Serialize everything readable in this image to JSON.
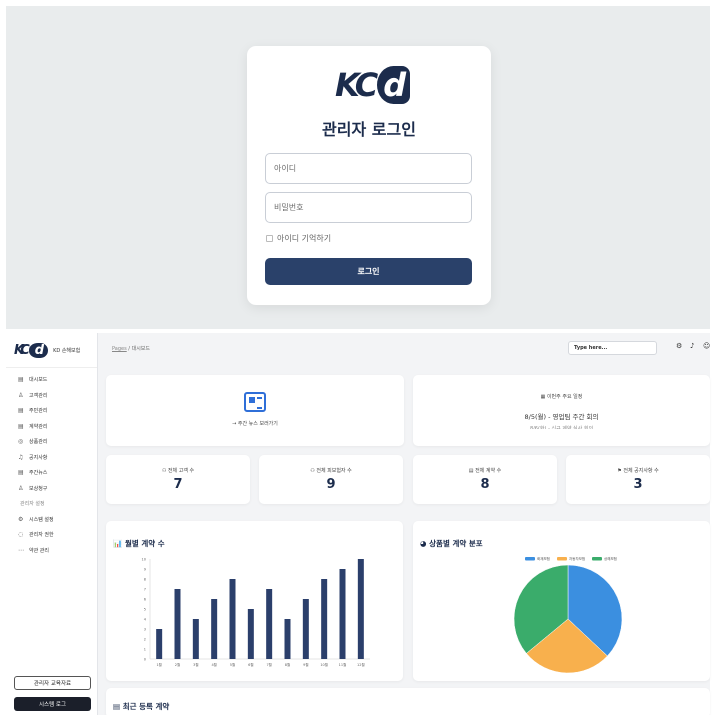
{
  "login": {
    "logo_text": "KC",
    "logo_d": "d",
    "title": "관리자 로그인",
    "id_placeholder": "아이디",
    "pw_placeholder": "비밀번호",
    "remember_label": "아이디 기억하기",
    "submit_label": "로그인"
  },
  "sidebar": {
    "logo_text": "KC",
    "logo_d": "d",
    "brand": "KD 손해보험",
    "items": [
      {
        "icon": "▤",
        "label": "대시보드"
      },
      {
        "icon": "♙",
        "label": "고객관리"
      },
      {
        "icon": "▤",
        "label": "주민관리"
      },
      {
        "icon": "▤",
        "label": "계약관리"
      },
      {
        "icon": "◎",
        "label": "상품관리"
      },
      {
        "icon": "♫",
        "label": "공지사항"
      },
      {
        "icon": "▤",
        "label": "주간뉴스"
      },
      {
        "icon": "♙",
        "label": "보상청구"
      }
    ],
    "section_label": "관리자 설정",
    "admin_items": [
      {
        "icon": "⚙",
        "label": "시스템 설정"
      },
      {
        "icon": "◌",
        "label": "관리자 권한"
      },
      {
        "icon": "⋯",
        "label": "약관 관리"
      }
    ],
    "manual_button": "관리자 교육자료",
    "log_button": "시스템 로그"
  },
  "topbar": {
    "crumb_page": "Pages",
    "crumb_sep": " / ",
    "crumb_current": "대시보드",
    "search_placeholder": "Type here...",
    "icons": [
      "gear-icon",
      "bell-icon",
      "user-icon"
    ]
  },
  "news": {
    "link": "→ 주간 뉴스 보러가기"
  },
  "schedule": {
    "title": "▦ 이번주 주요 일정",
    "item": "8/5(월) - 영업팀 주간 회의",
    "item2": "8/6(화) - 신규 계약 심사 회의"
  },
  "stats": [
    {
      "label": "⚇ 전체 고객 수",
      "value": "7"
    },
    {
      "label": "⚇ 전체 피보험자 수",
      "value": "9"
    },
    {
      "label": "▤ 전체 계약 수",
      "value": "8"
    },
    {
      "label": "⚑ 전체 공지사항 수",
      "value": "3"
    }
  ],
  "bar_chart_title": "월별 계약 수",
  "pie_chart_title": "상품별 계약 분포",
  "recent_title": "최근 등록 계약",
  "colors": {
    "navy": "#2a416a",
    "bar": "#2b3f6b",
    "pie_blue": "#3b8fe0",
    "pie_orange": "#f8b04d",
    "pie_green": "#3aac6b"
  },
  "chart_data": [
    {
      "type": "bar",
      "title": "월별 계약 수",
      "categories": [
        "1월",
        "2월",
        "3월",
        "4월",
        "5월",
        "6월",
        "7월",
        "8월",
        "9월",
        "10월",
        "11월",
        "12월"
      ],
      "values": [
        3,
        7,
        4,
        6,
        8,
        5,
        7,
        4,
        6,
        8,
        9,
        10
      ],
      "ylim": [
        0,
        10
      ],
      "yticks": [
        0,
        1,
        2,
        3,
        4,
        5,
        6,
        7,
        8,
        9,
        10
      ],
      "grid": false
    },
    {
      "type": "pie",
      "title": "상품별 계약 분포",
      "legend_position": "top",
      "series": [
        {
          "name": "화재보험",
          "value": 37,
          "color": "#3b8fe0"
        },
        {
          "name": "자동차보험",
          "value": 27,
          "color": "#f8b04d"
        },
        {
          "name": "상해보험",
          "value": 36,
          "color": "#3aac6b"
        }
      ]
    }
  ]
}
